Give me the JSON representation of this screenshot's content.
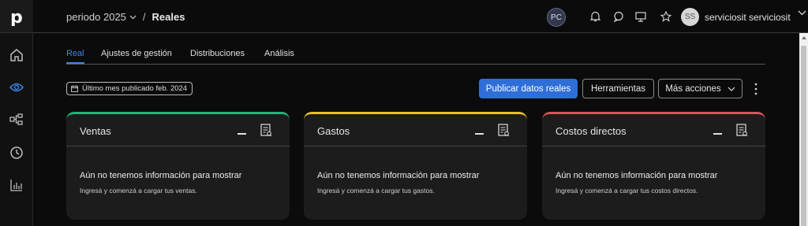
{
  "app": {
    "logo_letter": "p"
  },
  "sidebar": {
    "items": [
      {
        "name": "home-icon"
      },
      {
        "name": "eye-icon",
        "active": true
      },
      {
        "name": "hierarchy-icon"
      },
      {
        "name": "clock-icon"
      },
      {
        "name": "bar-chart-icon"
      }
    ]
  },
  "header": {
    "period": "periodo 2025",
    "separator": "/",
    "current": "Reales",
    "badge": "PC",
    "user_initials": "SS",
    "user_name": "serviciosit serviciosit"
  },
  "tabs": [
    {
      "label": "Real",
      "active": true
    },
    {
      "label": "Ajustes de gestión"
    },
    {
      "label": "Distribuciones"
    },
    {
      "label": "Análisis"
    }
  ],
  "toolbar": {
    "last_month_label": "Último mes publicado feb. 2024",
    "publish_label": "Publicar datos reales",
    "tools_label": "Herramientas",
    "more_label": "Más acciones"
  },
  "cards": [
    {
      "title": "Ventas",
      "message": "Aún no tenemos información para mostrar",
      "sub": "Ingresá y comenzá a cargar tus ventas.",
      "accent": "#1db87a"
    },
    {
      "title": "Gastos",
      "message": "Aún no tenemos información para mostrar",
      "sub": "Ingresá y comenzá a cargar tus gastos.",
      "accent": "#e8c21e"
    },
    {
      "title": "Costos directos",
      "message": "Aún no tenemos información para mostrar",
      "sub": "Ingresá y comenzá a cargar tus costos directos.",
      "accent": "#e0505a"
    }
  ],
  "colors": {
    "primary": "#2e6ed8",
    "active_tab": "#3d85e6"
  }
}
